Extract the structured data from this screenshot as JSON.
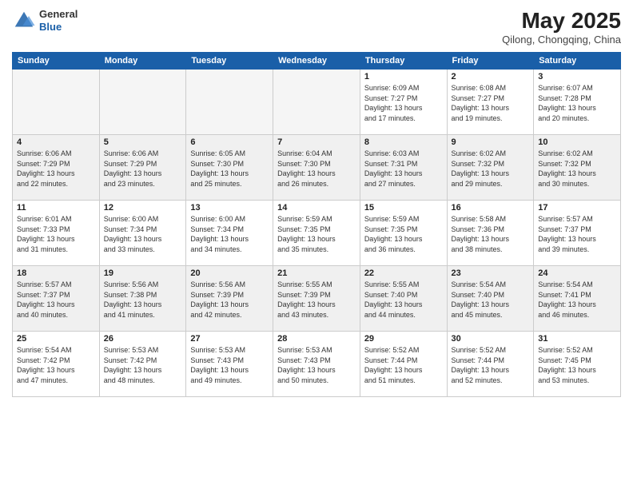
{
  "header": {
    "logo_general": "General",
    "logo_blue": "Blue",
    "month": "May 2025",
    "location": "Qilong, Chongqing, China"
  },
  "days_of_week": [
    "Sunday",
    "Monday",
    "Tuesday",
    "Wednesday",
    "Thursday",
    "Friday",
    "Saturday"
  ],
  "weeks": [
    [
      {
        "day": "",
        "info": ""
      },
      {
        "day": "",
        "info": ""
      },
      {
        "day": "",
        "info": ""
      },
      {
        "day": "",
        "info": ""
      },
      {
        "day": "1",
        "info": "Sunrise: 6:09 AM\nSunset: 7:27 PM\nDaylight: 13 hours\nand 17 minutes."
      },
      {
        "day": "2",
        "info": "Sunrise: 6:08 AM\nSunset: 7:27 PM\nDaylight: 13 hours\nand 19 minutes."
      },
      {
        "day": "3",
        "info": "Sunrise: 6:07 AM\nSunset: 7:28 PM\nDaylight: 13 hours\nand 20 minutes."
      }
    ],
    [
      {
        "day": "4",
        "info": "Sunrise: 6:06 AM\nSunset: 7:29 PM\nDaylight: 13 hours\nand 22 minutes."
      },
      {
        "day": "5",
        "info": "Sunrise: 6:06 AM\nSunset: 7:29 PM\nDaylight: 13 hours\nand 23 minutes."
      },
      {
        "day": "6",
        "info": "Sunrise: 6:05 AM\nSunset: 7:30 PM\nDaylight: 13 hours\nand 25 minutes."
      },
      {
        "day": "7",
        "info": "Sunrise: 6:04 AM\nSunset: 7:30 PM\nDaylight: 13 hours\nand 26 minutes."
      },
      {
        "day": "8",
        "info": "Sunrise: 6:03 AM\nSunset: 7:31 PM\nDaylight: 13 hours\nand 27 minutes."
      },
      {
        "day": "9",
        "info": "Sunrise: 6:02 AM\nSunset: 7:32 PM\nDaylight: 13 hours\nand 29 minutes."
      },
      {
        "day": "10",
        "info": "Sunrise: 6:02 AM\nSunset: 7:32 PM\nDaylight: 13 hours\nand 30 minutes."
      }
    ],
    [
      {
        "day": "11",
        "info": "Sunrise: 6:01 AM\nSunset: 7:33 PM\nDaylight: 13 hours\nand 31 minutes."
      },
      {
        "day": "12",
        "info": "Sunrise: 6:00 AM\nSunset: 7:34 PM\nDaylight: 13 hours\nand 33 minutes."
      },
      {
        "day": "13",
        "info": "Sunrise: 6:00 AM\nSunset: 7:34 PM\nDaylight: 13 hours\nand 34 minutes."
      },
      {
        "day": "14",
        "info": "Sunrise: 5:59 AM\nSunset: 7:35 PM\nDaylight: 13 hours\nand 35 minutes."
      },
      {
        "day": "15",
        "info": "Sunrise: 5:59 AM\nSunset: 7:35 PM\nDaylight: 13 hours\nand 36 minutes."
      },
      {
        "day": "16",
        "info": "Sunrise: 5:58 AM\nSunset: 7:36 PM\nDaylight: 13 hours\nand 38 minutes."
      },
      {
        "day": "17",
        "info": "Sunrise: 5:57 AM\nSunset: 7:37 PM\nDaylight: 13 hours\nand 39 minutes."
      }
    ],
    [
      {
        "day": "18",
        "info": "Sunrise: 5:57 AM\nSunset: 7:37 PM\nDaylight: 13 hours\nand 40 minutes."
      },
      {
        "day": "19",
        "info": "Sunrise: 5:56 AM\nSunset: 7:38 PM\nDaylight: 13 hours\nand 41 minutes."
      },
      {
        "day": "20",
        "info": "Sunrise: 5:56 AM\nSunset: 7:39 PM\nDaylight: 13 hours\nand 42 minutes."
      },
      {
        "day": "21",
        "info": "Sunrise: 5:55 AM\nSunset: 7:39 PM\nDaylight: 13 hours\nand 43 minutes."
      },
      {
        "day": "22",
        "info": "Sunrise: 5:55 AM\nSunset: 7:40 PM\nDaylight: 13 hours\nand 44 minutes."
      },
      {
        "day": "23",
        "info": "Sunrise: 5:54 AM\nSunset: 7:40 PM\nDaylight: 13 hours\nand 45 minutes."
      },
      {
        "day": "24",
        "info": "Sunrise: 5:54 AM\nSunset: 7:41 PM\nDaylight: 13 hours\nand 46 minutes."
      }
    ],
    [
      {
        "day": "25",
        "info": "Sunrise: 5:54 AM\nSunset: 7:42 PM\nDaylight: 13 hours\nand 47 minutes."
      },
      {
        "day": "26",
        "info": "Sunrise: 5:53 AM\nSunset: 7:42 PM\nDaylight: 13 hours\nand 48 minutes."
      },
      {
        "day": "27",
        "info": "Sunrise: 5:53 AM\nSunset: 7:43 PM\nDaylight: 13 hours\nand 49 minutes."
      },
      {
        "day": "28",
        "info": "Sunrise: 5:53 AM\nSunset: 7:43 PM\nDaylight: 13 hours\nand 50 minutes."
      },
      {
        "day": "29",
        "info": "Sunrise: 5:52 AM\nSunset: 7:44 PM\nDaylight: 13 hours\nand 51 minutes."
      },
      {
        "day": "30",
        "info": "Sunrise: 5:52 AM\nSunset: 7:44 PM\nDaylight: 13 hours\nand 52 minutes."
      },
      {
        "day": "31",
        "info": "Sunrise: 5:52 AM\nSunset: 7:45 PM\nDaylight: 13 hours\nand 53 minutes."
      }
    ]
  ]
}
